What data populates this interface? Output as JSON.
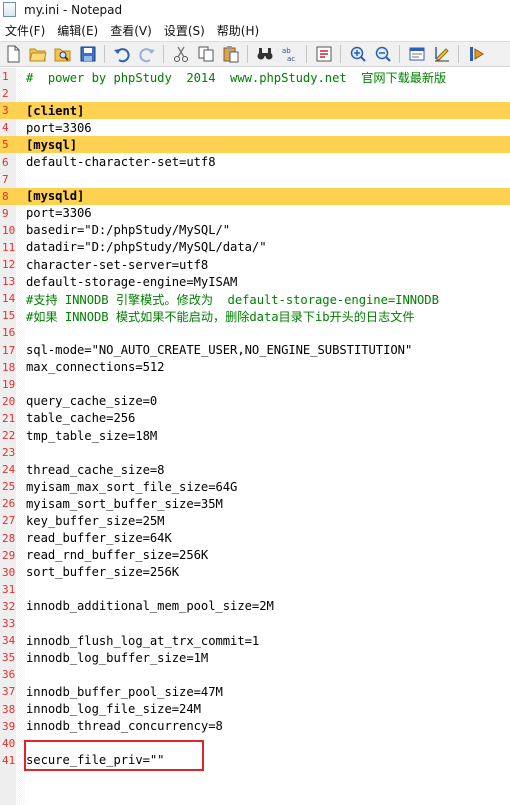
{
  "window": {
    "title": "my.ini - Notepad"
  },
  "menu": {
    "items": [
      {
        "label": "文件(F)"
      },
      {
        "label": "编辑(E)"
      },
      {
        "label": "查看(V)"
      },
      {
        "label": "设置(S)"
      },
      {
        "label": "帮助(H)"
      }
    ]
  },
  "toolbar": {
    "buttons": [
      "new-file-icon",
      "open-file-icon",
      "find-file-icon",
      "save-icon",
      "undo-icon",
      "redo-icon",
      "cut-icon",
      "copy-icon",
      "paste-icon",
      "find-icon",
      "replace-icon",
      "goto-icon",
      "zoom-in-icon",
      "zoom-out-icon",
      "options-icon",
      "edit-icon",
      "run-icon"
    ]
  },
  "editor": {
    "lines": [
      {
        "n": "1",
        "text": "#  power by phpStudy  2014  www.phpStudy.net  官网下载最新版",
        "kind": "comment"
      },
      {
        "n": "2",
        "text": "",
        "kind": "plain"
      },
      {
        "n": "3",
        "text": "[client]",
        "kind": "section"
      },
      {
        "n": "4",
        "text": "port=3306",
        "kind": "plain"
      },
      {
        "n": "5",
        "text": "[mysql]",
        "kind": "section"
      },
      {
        "n": "6",
        "text": "default-character-set=utf8",
        "kind": "plain"
      },
      {
        "n": "7",
        "text": "",
        "kind": "plain"
      },
      {
        "n": "8",
        "text": "[mysqld]",
        "kind": "section"
      },
      {
        "n": "9",
        "text": "port=3306",
        "kind": "plain"
      },
      {
        "n": "10",
        "text": "basedir=\"D:/phpStudy/MySQL/\"",
        "kind": "plain"
      },
      {
        "n": "11",
        "text": "datadir=\"D:/phpStudy/MySQL/data/\"",
        "kind": "plain"
      },
      {
        "n": "12",
        "text": "character-set-server=utf8",
        "kind": "plain"
      },
      {
        "n": "13",
        "text": "default-storage-engine=MyISAM",
        "kind": "plain"
      },
      {
        "n": "14",
        "text": "#支持 INNODB 引擎模式。修改为  default-storage-engine=INNODB",
        "kind": "comment"
      },
      {
        "n": "15",
        "text": "#如果 INNODB 模式如果不能启动，删除data目录下ib开头的日志文件",
        "kind": "comment"
      },
      {
        "n": "16",
        "text": "",
        "kind": "plain"
      },
      {
        "n": "17",
        "text": "sql-mode=\"NO_AUTO_CREATE_USER,NO_ENGINE_SUBSTITUTION\"",
        "kind": "plain"
      },
      {
        "n": "18",
        "text": "max_connections=512",
        "kind": "plain"
      },
      {
        "n": "19",
        "text": "",
        "kind": "plain"
      },
      {
        "n": "20",
        "text": "query_cache_size=0",
        "kind": "plain"
      },
      {
        "n": "21",
        "text": "table_cache=256",
        "kind": "plain"
      },
      {
        "n": "22",
        "text": "tmp_table_size=18M",
        "kind": "plain"
      },
      {
        "n": "23",
        "text": "",
        "kind": "plain"
      },
      {
        "n": "24",
        "text": "thread_cache_size=8",
        "kind": "plain"
      },
      {
        "n": "25",
        "text": "myisam_max_sort_file_size=64G",
        "kind": "plain"
      },
      {
        "n": "26",
        "text": "myisam_sort_buffer_size=35M",
        "kind": "plain"
      },
      {
        "n": "27",
        "text": "key_buffer_size=25M",
        "kind": "plain"
      },
      {
        "n": "28",
        "text": "read_buffer_size=64K",
        "kind": "plain"
      },
      {
        "n": "29",
        "text": "read_rnd_buffer_size=256K",
        "kind": "plain"
      },
      {
        "n": "30",
        "text": "sort_buffer_size=256K",
        "kind": "plain"
      },
      {
        "n": "31",
        "text": "",
        "kind": "plain"
      },
      {
        "n": "32",
        "text": "innodb_additional_mem_pool_size=2M",
        "kind": "plain"
      },
      {
        "n": "33",
        "text": "",
        "kind": "plain"
      },
      {
        "n": "34",
        "text": "innodb_flush_log_at_trx_commit=1",
        "kind": "plain"
      },
      {
        "n": "35",
        "text": "innodb_log_buffer_size=1M",
        "kind": "plain"
      },
      {
        "n": "36",
        "text": "",
        "kind": "plain"
      },
      {
        "n": "37",
        "text": "innodb_buffer_pool_size=47M",
        "kind": "plain"
      },
      {
        "n": "38",
        "text": "innodb_log_file_size=24M",
        "kind": "plain"
      },
      {
        "n": "39",
        "text": "innodb_thread_concurrency=8",
        "kind": "plain"
      },
      {
        "n": "40",
        "text": "",
        "kind": "plain"
      },
      {
        "n": "41",
        "text": "secure_file_priv=\"\"",
        "kind": "plain"
      }
    ],
    "highlight_color": "#e0242c",
    "section_bg": "#ffd150",
    "comment_color": "#008000",
    "line_number_color": "#e03030"
  }
}
